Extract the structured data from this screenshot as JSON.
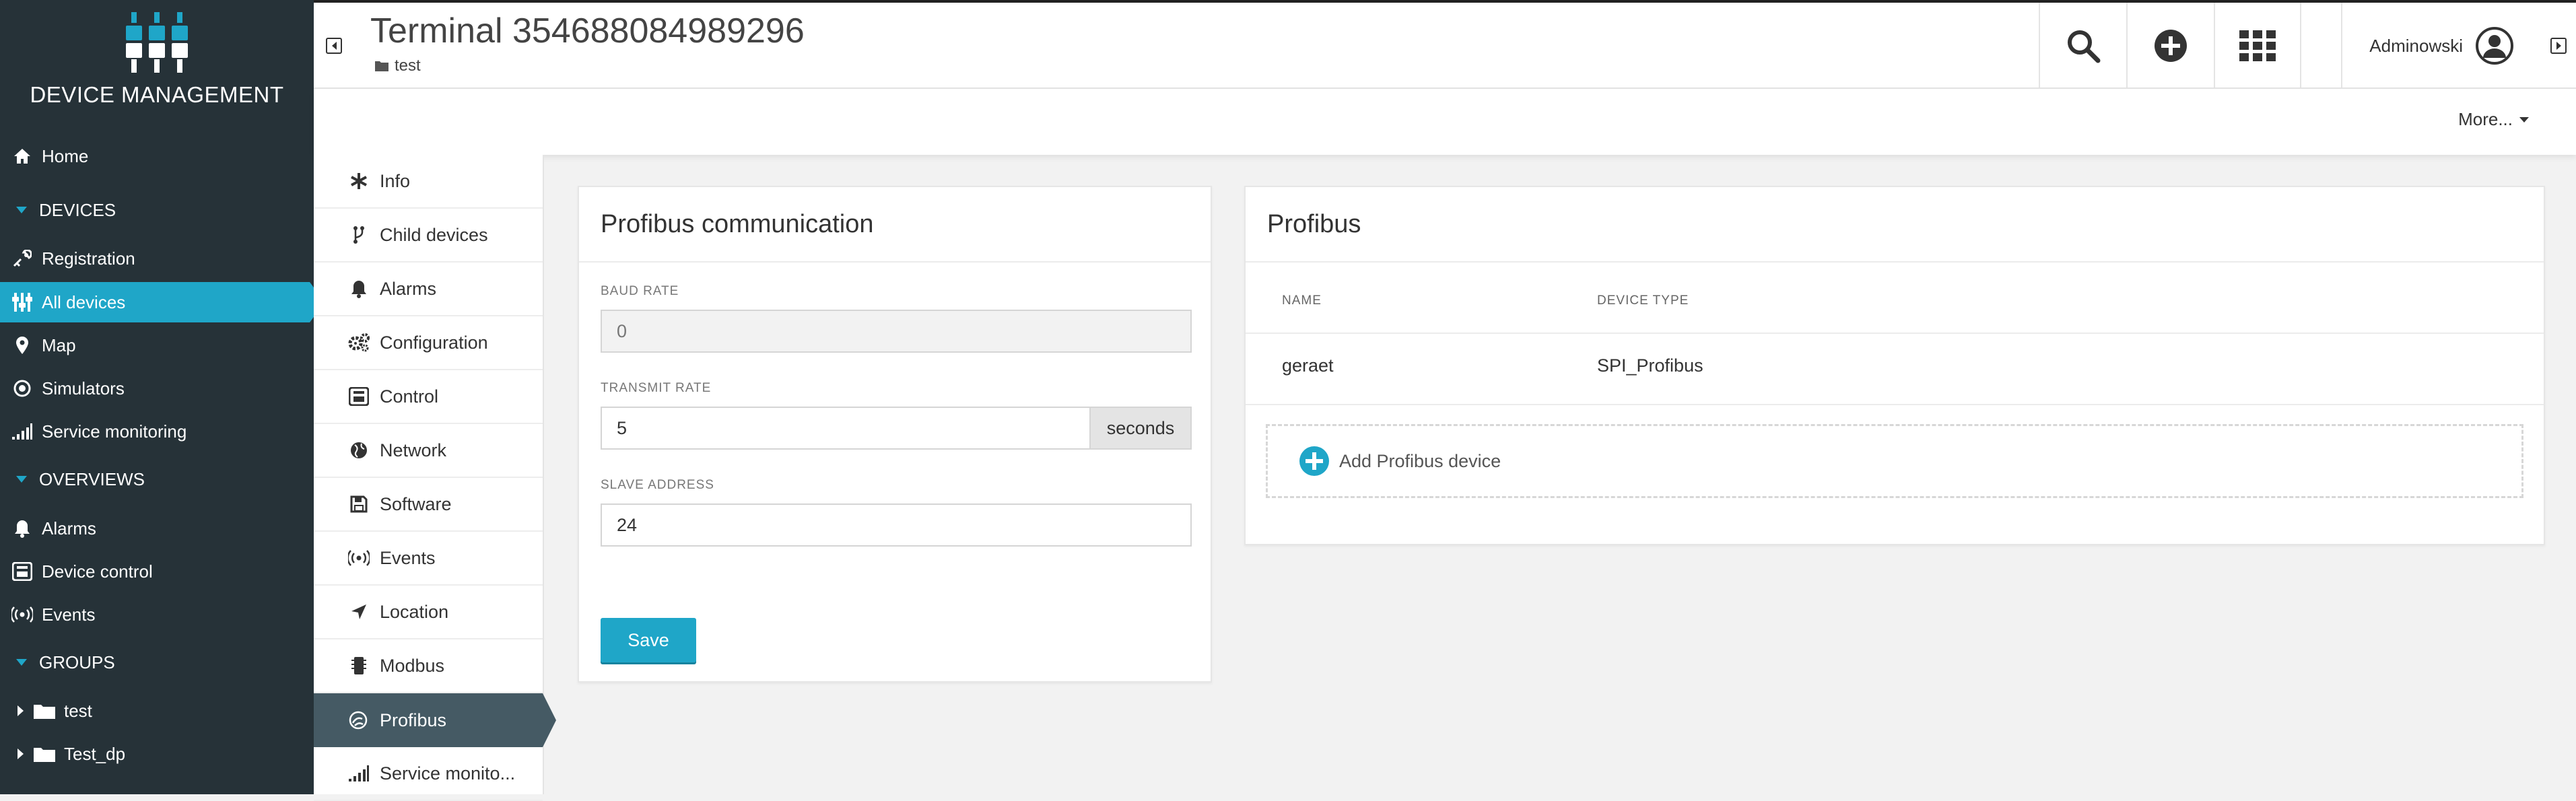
{
  "brand": {
    "title": "DEVICE MANAGEMENT",
    "logo_icon": "device-management-logo-icon"
  },
  "nav": {
    "home": "Home",
    "devices_section": "DEVICES",
    "registration": "Registration",
    "all_devices": "All devices",
    "map": "Map",
    "simulators": "Simulators",
    "service_monitoring": "Service monitoring",
    "overviews_section": "OVERVIEWS",
    "alarms": "Alarms",
    "device_control": "Device control",
    "events": "Events",
    "groups_section": "GROUPS",
    "groups": [
      "test",
      "Test_dp"
    ]
  },
  "header": {
    "title": "Terminal 354688084989296",
    "breadcrumb": "test",
    "user": "Adminowski",
    "more": "More..."
  },
  "tabs": [
    "Info",
    "Child devices",
    "Alarms",
    "Configuration",
    "Control",
    "Network",
    "Software",
    "Events",
    "Location",
    "Modbus",
    "Profibus",
    "Service monito..."
  ],
  "active_tab": "Profibus",
  "comm_card": {
    "title": "Profibus communication",
    "baud_rate_label": "BAUD RATE",
    "baud_rate_value": "0",
    "transmit_rate_label": "TRANSMIT RATE",
    "transmit_rate_value": "5",
    "transmit_rate_unit": "seconds",
    "slave_address_label": "SLAVE ADDRESS",
    "slave_address_value": "24",
    "save_label": "Save"
  },
  "profibus_card": {
    "title": "Profibus",
    "col_name": "NAME",
    "col_type": "DEVICE TYPE",
    "rows": [
      {
        "name": "geraet",
        "type": "SPI_Profibus"
      }
    ],
    "add_label": "Add Profibus device"
  },
  "colors": {
    "accent": "#1fa6c8",
    "sidebar_bg": "#263238",
    "active_tab_bg": "#455a64"
  }
}
